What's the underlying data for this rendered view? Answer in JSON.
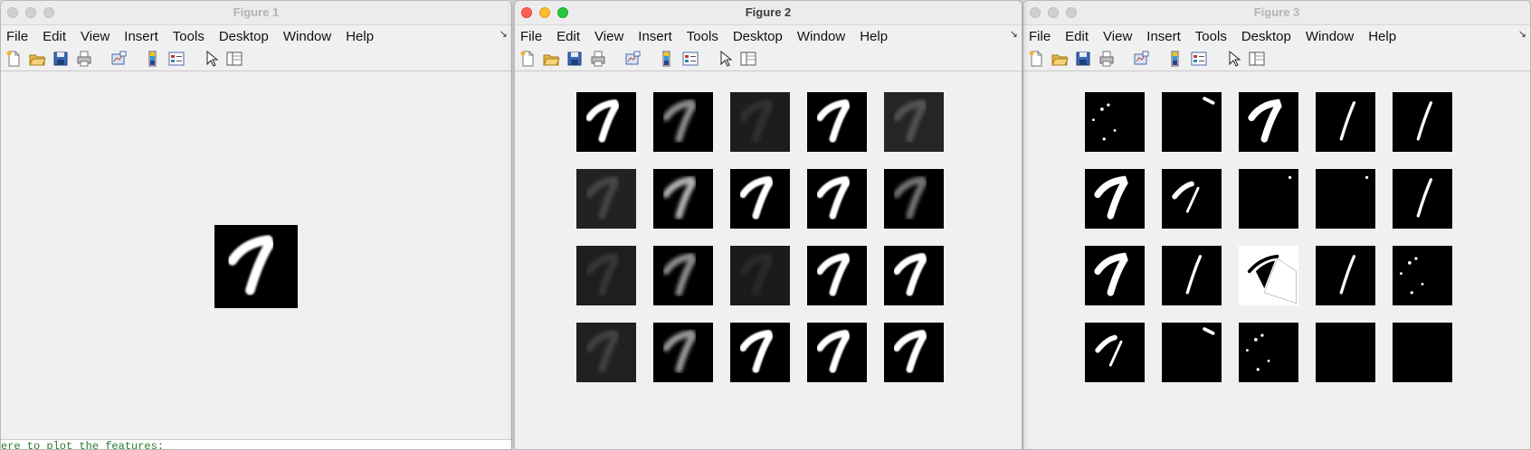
{
  "menu_labels": [
    "File",
    "Edit",
    "View",
    "Insert",
    "Tools",
    "Desktop",
    "Window",
    "Help"
  ],
  "toolbar_icons": [
    "new-figure-icon",
    "open-file-icon",
    "save-icon",
    "print-icon",
    "link-plot-icon",
    "insert-colorbar-icon",
    "insert-legend-icon",
    "pointer-icon",
    "property-editor-icon"
  ],
  "windows": [
    {
      "title": "Figure 1",
      "active": false
    },
    {
      "title": "Figure 2",
      "active": true
    },
    {
      "title": "Figure 3",
      "active": false
    }
  ],
  "figure1": {
    "image": "digit-7-grayscale"
  },
  "figure2": {
    "grid_rows": 4,
    "grid_cols": 5,
    "brightness": [
      [
        1.0,
        0.55,
        0.12,
        1.0,
        0.25
      ],
      [
        0.2,
        0.7,
        1.0,
        1.0,
        0.45
      ],
      [
        0.14,
        0.55,
        0.08,
        1.0,
        1.0
      ],
      [
        0.18,
        0.6,
        1.0,
        1.0,
        1.0
      ]
    ]
  },
  "figure3": {
    "grid_rows": 4,
    "grid_cols": 5,
    "patterns": [
      [
        "sparse",
        "corner",
        "full",
        "thin",
        "thin"
      ],
      [
        "full",
        "partial",
        "dot",
        "dot",
        "thin"
      ],
      [
        "full",
        "thin",
        "inverse",
        "thin",
        "sparse"
      ],
      [
        "partial",
        "corner",
        "sparse",
        "empty",
        "empty"
      ]
    ]
  },
  "command_window": {
    "text": "ere to plot the features:"
  },
  "colors": {
    "close": "#ff5f57",
    "minimize": "#febc2e",
    "maximize": "#28c840"
  }
}
